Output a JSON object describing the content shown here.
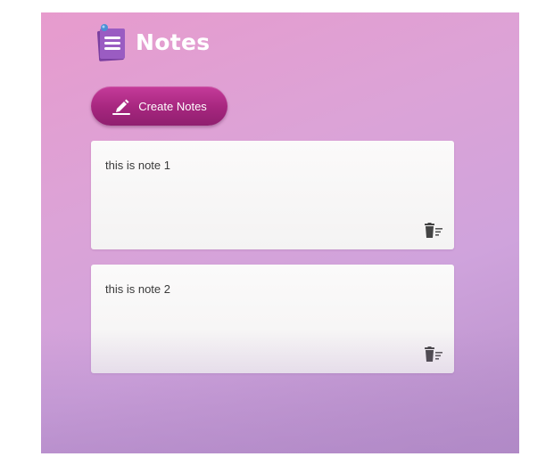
{
  "header": {
    "title": "Notes",
    "icon": "notepad-icon"
  },
  "toolbar": {
    "create_label": "Create Notes",
    "create_icon": "pencil-icon"
  },
  "notes": [
    {
      "text": "this is note 1",
      "delete_icon": "delete-icon"
    },
    {
      "text": "this is note 2",
      "delete_icon": "delete-icon"
    }
  ],
  "colors": {
    "background_top": "#e79bcd",
    "background_bottom": "#b68fc9",
    "button": "#a6267e",
    "note_background": "#fbfafa",
    "title": "#ffffff"
  }
}
